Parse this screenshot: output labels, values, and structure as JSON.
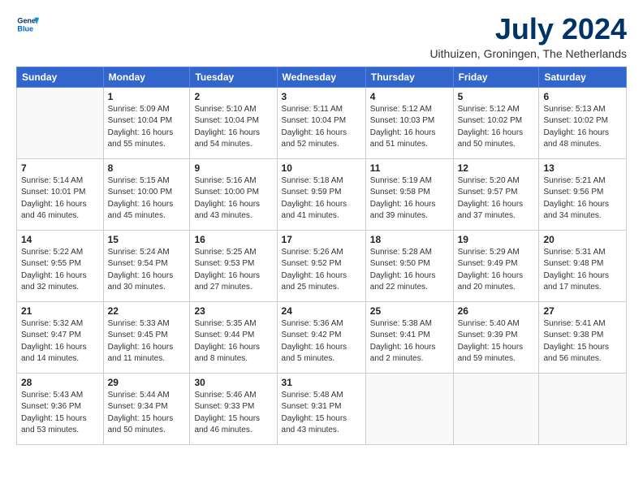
{
  "logo": {
    "line1": "General",
    "line2": "Blue"
  },
  "title": "July 2024",
  "subtitle": "Uithuizen, Groningen, The Netherlands",
  "headers": [
    "Sunday",
    "Monday",
    "Tuesday",
    "Wednesday",
    "Thursday",
    "Friday",
    "Saturday"
  ],
  "weeks": [
    [
      {
        "day": "",
        "info": ""
      },
      {
        "day": "1",
        "info": "Sunrise: 5:09 AM\nSunset: 10:04 PM\nDaylight: 16 hours\nand 55 minutes."
      },
      {
        "day": "2",
        "info": "Sunrise: 5:10 AM\nSunset: 10:04 PM\nDaylight: 16 hours\nand 54 minutes."
      },
      {
        "day": "3",
        "info": "Sunrise: 5:11 AM\nSunset: 10:04 PM\nDaylight: 16 hours\nand 52 minutes."
      },
      {
        "day": "4",
        "info": "Sunrise: 5:12 AM\nSunset: 10:03 PM\nDaylight: 16 hours\nand 51 minutes."
      },
      {
        "day": "5",
        "info": "Sunrise: 5:12 AM\nSunset: 10:02 PM\nDaylight: 16 hours\nand 50 minutes."
      },
      {
        "day": "6",
        "info": "Sunrise: 5:13 AM\nSunset: 10:02 PM\nDaylight: 16 hours\nand 48 minutes."
      }
    ],
    [
      {
        "day": "7",
        "info": "Sunrise: 5:14 AM\nSunset: 10:01 PM\nDaylight: 16 hours\nand 46 minutes."
      },
      {
        "day": "8",
        "info": "Sunrise: 5:15 AM\nSunset: 10:00 PM\nDaylight: 16 hours\nand 45 minutes."
      },
      {
        "day": "9",
        "info": "Sunrise: 5:16 AM\nSunset: 10:00 PM\nDaylight: 16 hours\nand 43 minutes."
      },
      {
        "day": "10",
        "info": "Sunrise: 5:18 AM\nSunset: 9:59 PM\nDaylight: 16 hours\nand 41 minutes."
      },
      {
        "day": "11",
        "info": "Sunrise: 5:19 AM\nSunset: 9:58 PM\nDaylight: 16 hours\nand 39 minutes."
      },
      {
        "day": "12",
        "info": "Sunrise: 5:20 AM\nSunset: 9:57 PM\nDaylight: 16 hours\nand 37 minutes."
      },
      {
        "day": "13",
        "info": "Sunrise: 5:21 AM\nSunset: 9:56 PM\nDaylight: 16 hours\nand 34 minutes."
      }
    ],
    [
      {
        "day": "14",
        "info": "Sunrise: 5:22 AM\nSunset: 9:55 PM\nDaylight: 16 hours\nand 32 minutes."
      },
      {
        "day": "15",
        "info": "Sunrise: 5:24 AM\nSunset: 9:54 PM\nDaylight: 16 hours\nand 30 minutes."
      },
      {
        "day": "16",
        "info": "Sunrise: 5:25 AM\nSunset: 9:53 PM\nDaylight: 16 hours\nand 27 minutes."
      },
      {
        "day": "17",
        "info": "Sunrise: 5:26 AM\nSunset: 9:52 PM\nDaylight: 16 hours\nand 25 minutes."
      },
      {
        "day": "18",
        "info": "Sunrise: 5:28 AM\nSunset: 9:50 PM\nDaylight: 16 hours\nand 22 minutes."
      },
      {
        "day": "19",
        "info": "Sunrise: 5:29 AM\nSunset: 9:49 PM\nDaylight: 16 hours\nand 20 minutes."
      },
      {
        "day": "20",
        "info": "Sunrise: 5:31 AM\nSunset: 9:48 PM\nDaylight: 16 hours\nand 17 minutes."
      }
    ],
    [
      {
        "day": "21",
        "info": "Sunrise: 5:32 AM\nSunset: 9:47 PM\nDaylight: 16 hours\nand 14 minutes."
      },
      {
        "day": "22",
        "info": "Sunrise: 5:33 AM\nSunset: 9:45 PM\nDaylight: 16 hours\nand 11 minutes."
      },
      {
        "day": "23",
        "info": "Sunrise: 5:35 AM\nSunset: 9:44 PM\nDaylight: 16 hours\nand 8 minutes."
      },
      {
        "day": "24",
        "info": "Sunrise: 5:36 AM\nSunset: 9:42 PM\nDaylight: 16 hours\nand 5 minutes."
      },
      {
        "day": "25",
        "info": "Sunrise: 5:38 AM\nSunset: 9:41 PM\nDaylight: 16 hours\nand 2 minutes."
      },
      {
        "day": "26",
        "info": "Sunrise: 5:40 AM\nSunset: 9:39 PM\nDaylight: 15 hours\nand 59 minutes."
      },
      {
        "day": "27",
        "info": "Sunrise: 5:41 AM\nSunset: 9:38 PM\nDaylight: 15 hours\nand 56 minutes."
      }
    ],
    [
      {
        "day": "28",
        "info": "Sunrise: 5:43 AM\nSunset: 9:36 PM\nDaylight: 15 hours\nand 53 minutes."
      },
      {
        "day": "29",
        "info": "Sunrise: 5:44 AM\nSunset: 9:34 PM\nDaylight: 15 hours\nand 50 minutes."
      },
      {
        "day": "30",
        "info": "Sunrise: 5:46 AM\nSunset: 9:33 PM\nDaylight: 15 hours\nand 46 minutes."
      },
      {
        "day": "31",
        "info": "Sunrise: 5:48 AM\nSunset: 9:31 PM\nDaylight: 15 hours\nand 43 minutes."
      },
      {
        "day": "",
        "info": ""
      },
      {
        "day": "",
        "info": ""
      },
      {
        "day": "",
        "info": ""
      }
    ]
  ]
}
